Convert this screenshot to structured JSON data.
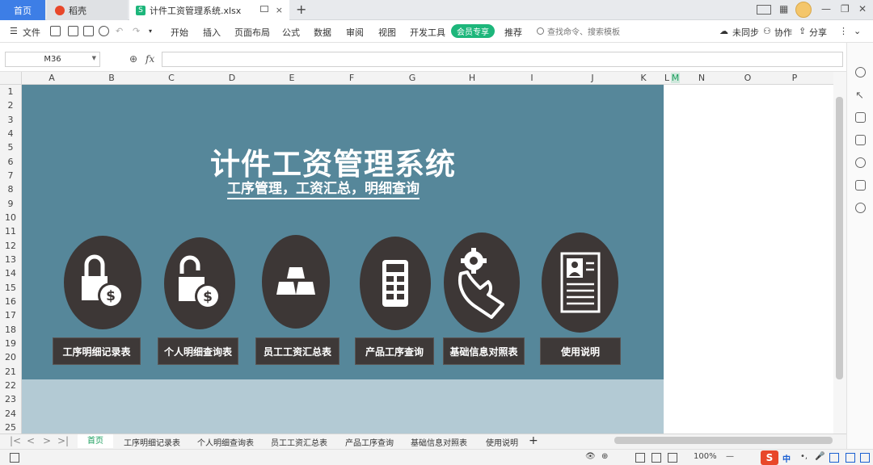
{
  "tabs": {
    "home": "首页",
    "daoke": "稻壳",
    "file": "计件工资管理系统.xlsx",
    "close": "×",
    "add": "+"
  },
  "ribbon": {
    "file_menu": "文件",
    "items": [
      "开始",
      "插入",
      "页面布局",
      "公式",
      "数据",
      "审阅",
      "视图",
      "开发工具"
    ],
    "vip": "会员专享",
    "recommend": "推荐",
    "search_placeholder": "查找命令、搜索模板",
    "sync": "未同步",
    "collab": "协作",
    "share": "分享"
  },
  "formula_bar": {
    "cell_ref": "M36",
    "fx": "fx",
    "value": ""
  },
  "columns": [
    "A",
    "B",
    "C",
    "D",
    "E",
    "F",
    "G",
    "H",
    "I",
    "J",
    "K",
    "L",
    "M",
    "N",
    "O",
    "P"
  ],
  "rows": [
    "1",
    "2",
    "3",
    "4",
    "5",
    "6",
    "7",
    "8",
    "9",
    "10",
    "11",
    "12",
    "13",
    "14",
    "15",
    "16",
    "17",
    "18",
    "19",
    "20",
    "21",
    "22",
    "23",
    "24",
    "25"
  ],
  "sheet": {
    "title": "计件工资管理系统",
    "subtitle": "工序管理，工资汇总，明细查询",
    "buttons": [
      {
        "label": "工序明细记录表",
        "icon": "lock-dollar-icon"
      },
      {
        "label": "个人明细查询表",
        "icon": "unlock-dollar-icon"
      },
      {
        "label": "员工工资汇总表",
        "icon": "gold-bars-icon"
      },
      {
        "label": "产品工序查询",
        "icon": "calculator-icon"
      },
      {
        "label": "基础信息对照表",
        "icon": "hand-gear-icon"
      },
      {
        "label": "使用说明",
        "icon": "document-person-icon"
      }
    ],
    "colors": {
      "banner": "#56879a",
      "oval": "#3d3736",
      "band": "#b3cad4"
    }
  },
  "sheet_tabs": [
    "首页",
    "工序明细记录表",
    "个人明细查询表",
    "员工工资汇总表",
    "产品工序查询",
    "基础信息对照表",
    "使用说明"
  ],
  "status": {
    "zoom": "100%",
    "ime": "中"
  }
}
